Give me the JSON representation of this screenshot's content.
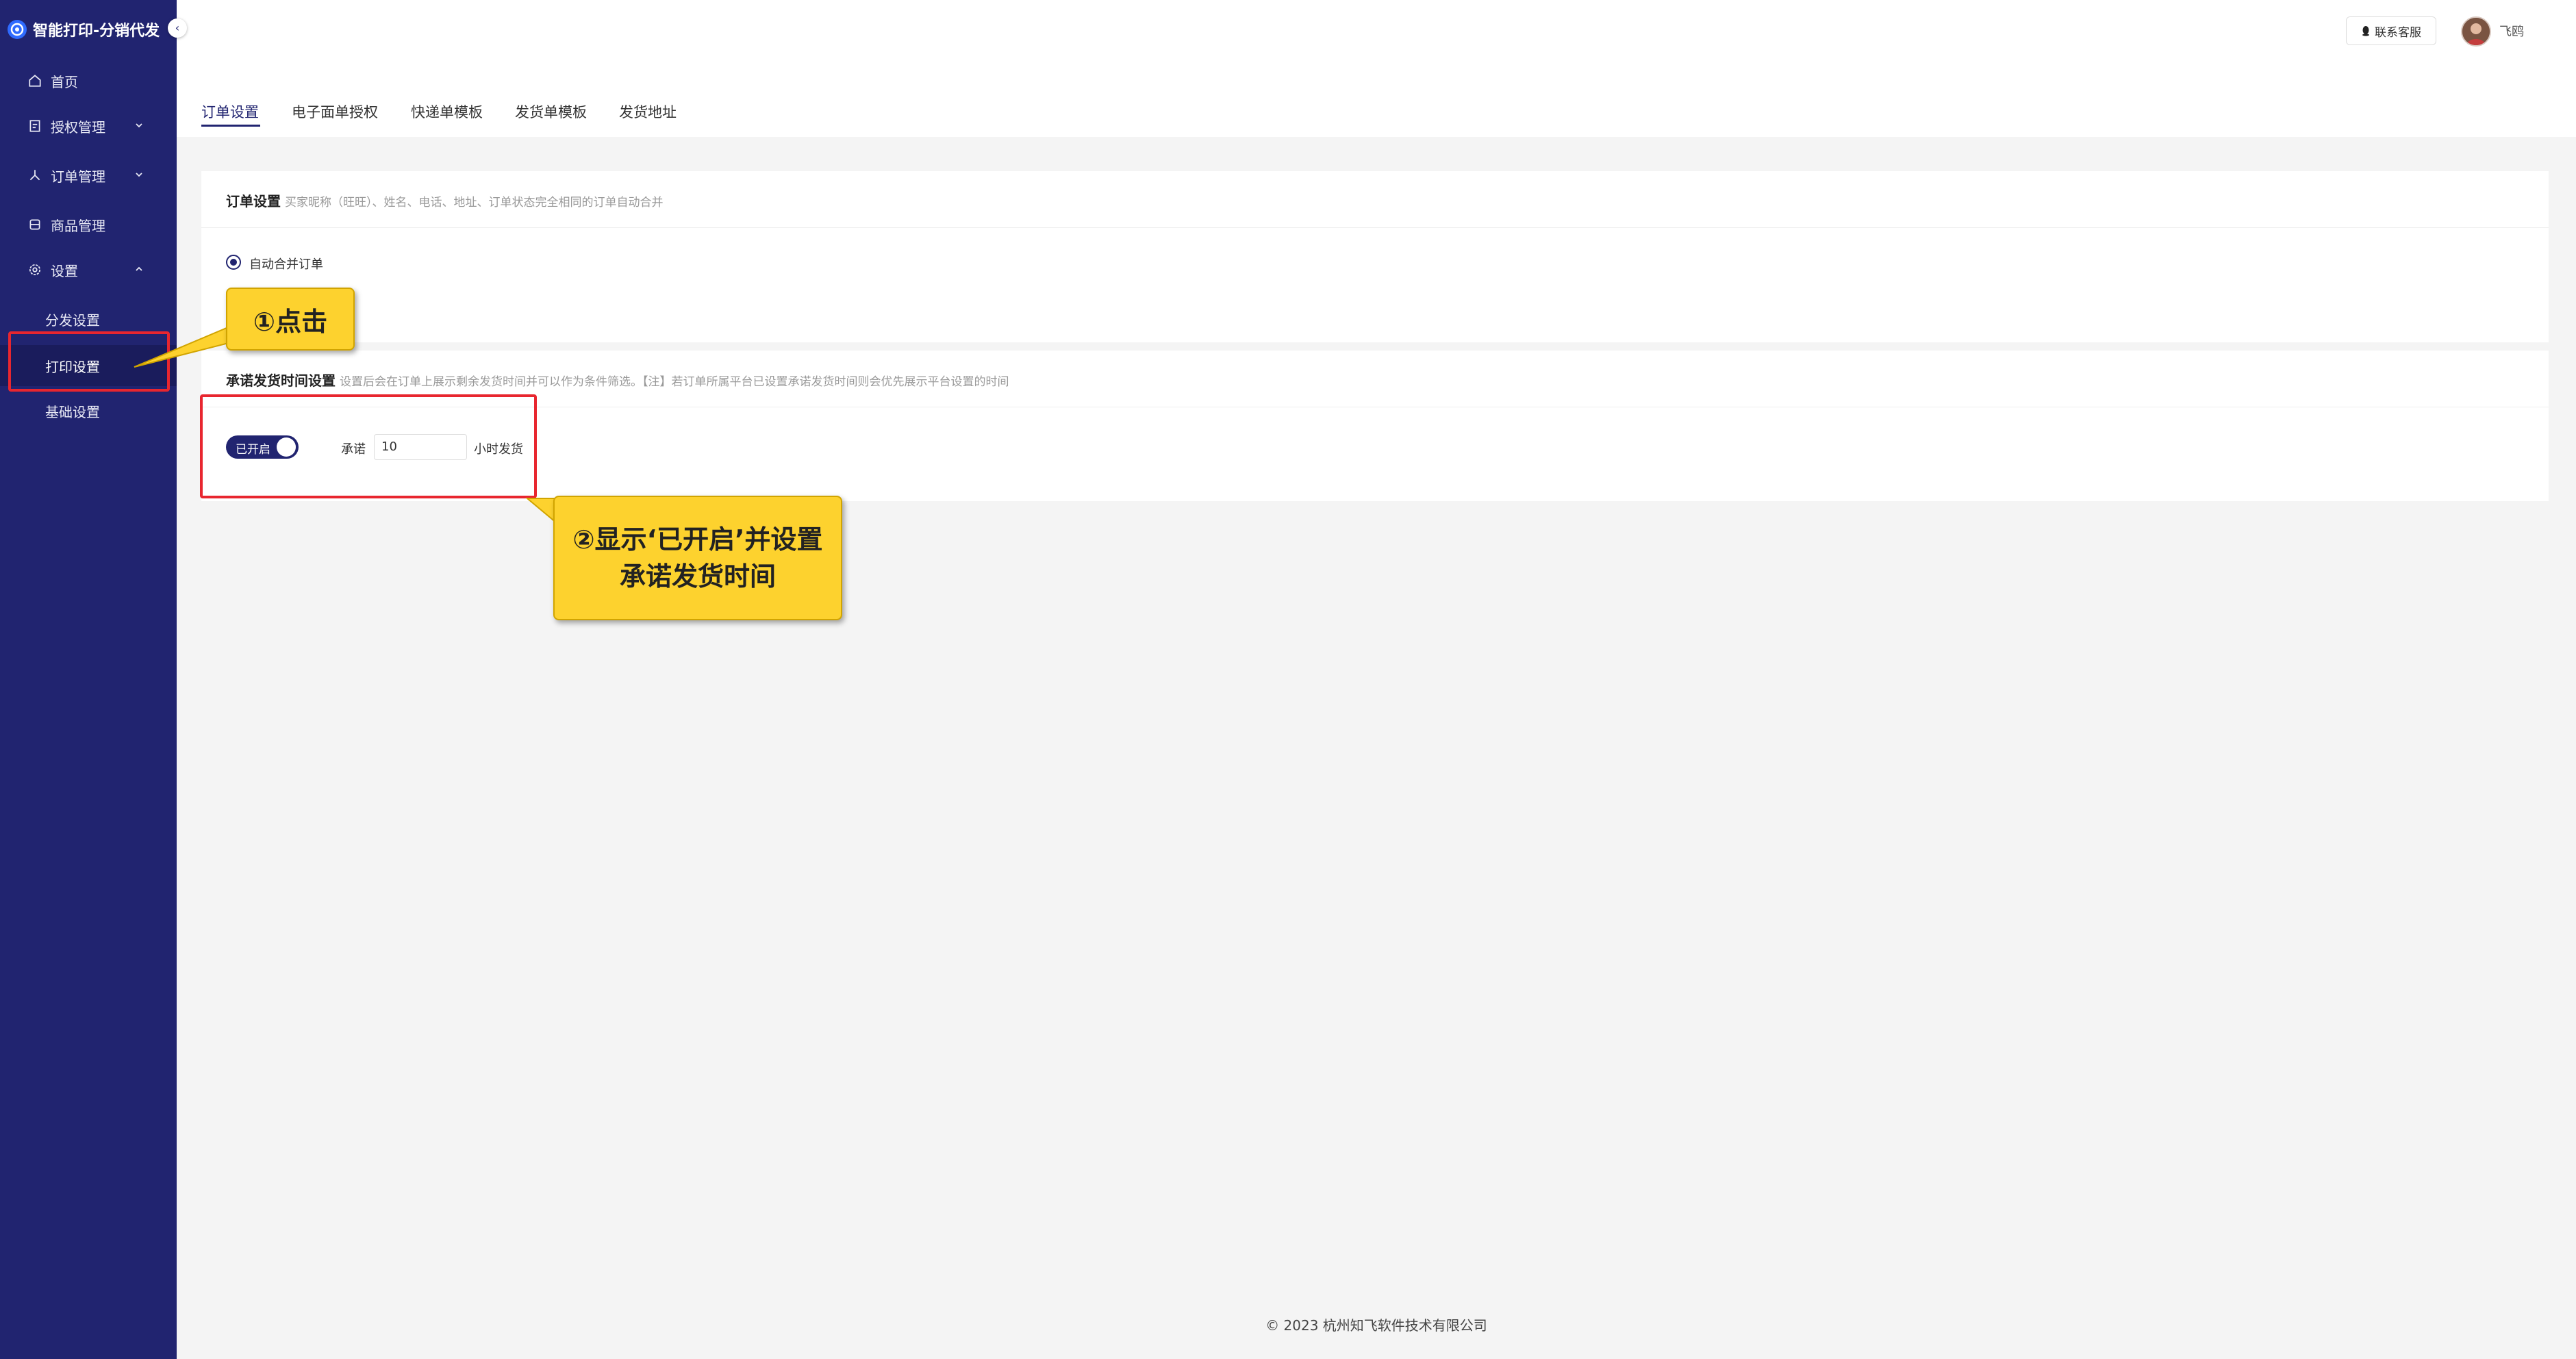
{
  "app": {
    "title": "智能打印-分销代发"
  },
  "sidebar": {
    "items": [
      {
        "label": "首页",
        "icon": "home-icon"
      },
      {
        "label": "授权管理",
        "icon": "authorization-icon",
        "expandable": true,
        "expanded": false
      },
      {
        "label": "订单管理",
        "icon": "order-icon",
        "expandable": true,
        "expanded": false
      },
      {
        "label": "商品管理",
        "icon": "product-icon"
      },
      {
        "label": "设置",
        "icon": "settings-icon",
        "expandable": true,
        "expanded": true
      }
    ],
    "sub_items": [
      {
        "label": "分发设置",
        "active": false
      },
      {
        "label": "打印设置",
        "active": true
      },
      {
        "label": "基础设置",
        "active": false
      }
    ]
  },
  "header": {
    "contact_label": "联系客服",
    "username": "飞鸥"
  },
  "tabs": [
    {
      "label": "订单设置",
      "active": true
    },
    {
      "label": "电子面单授权",
      "active": false
    },
    {
      "label": "快递单模板",
      "active": false
    },
    {
      "label": "发货单模板",
      "active": false
    },
    {
      "label": "发货地址",
      "active": false
    }
  ],
  "order_settings": {
    "title": "订单设置",
    "description": "买家昵称（旺旺）、姓名、电话、地址、订单状态完全相同的订单自动合并",
    "option_selected": "自动合并订单"
  },
  "promise_settings": {
    "title": "承诺发货时间设置",
    "description": "设置后会在订单上展示剩余发货时间并可以作为条件筛选。【注】若订单所属平台已设置承诺发货时间则会优先展示平台设置的时间",
    "toggle_label": "已开启",
    "toggle_on": true,
    "promise_label": "承诺",
    "hours_value": "10",
    "hours_unit": "小时发货"
  },
  "footer": {
    "copyright": "© 2023 杭州知飞软件技术有限公司"
  },
  "annotations": {
    "callout_1": "①点击",
    "callout_2": "②显示‘已开启’并设置承诺发货时间"
  },
  "colors": {
    "sidebar_bg": "#212470",
    "accent": "#212470",
    "highlight": "#e8262f",
    "callout": "#fdd22e"
  }
}
